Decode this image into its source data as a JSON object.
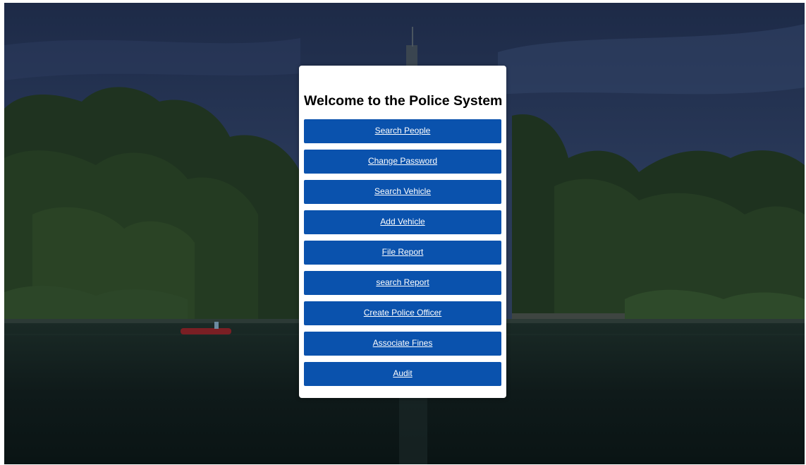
{
  "page": {
    "title": "Welcome to the Police System"
  },
  "menu": [
    {
      "name": "search-people-button",
      "label": "Search People"
    },
    {
      "name": "change-password-button",
      "label": "Change Password"
    },
    {
      "name": "search-vehicle-button",
      "label": "Search Vehicle"
    },
    {
      "name": "add-vehicle-button",
      "label": "Add Vehicle"
    },
    {
      "name": "file-report-button",
      "label": "File Report"
    },
    {
      "name": "search-report-button",
      "label": "search Report"
    },
    {
      "name": "create-police-officer-button",
      "label": "Create Police Officer"
    },
    {
      "name": "associate-fines-button",
      "label": "Associate Fines"
    },
    {
      "name": "audit-button",
      "label": "Audit"
    }
  ],
  "colors": {
    "button": "#0a52ad",
    "button_text": "#ffffff",
    "card": "#ffffff",
    "overlay": "#1b2a45"
  }
}
